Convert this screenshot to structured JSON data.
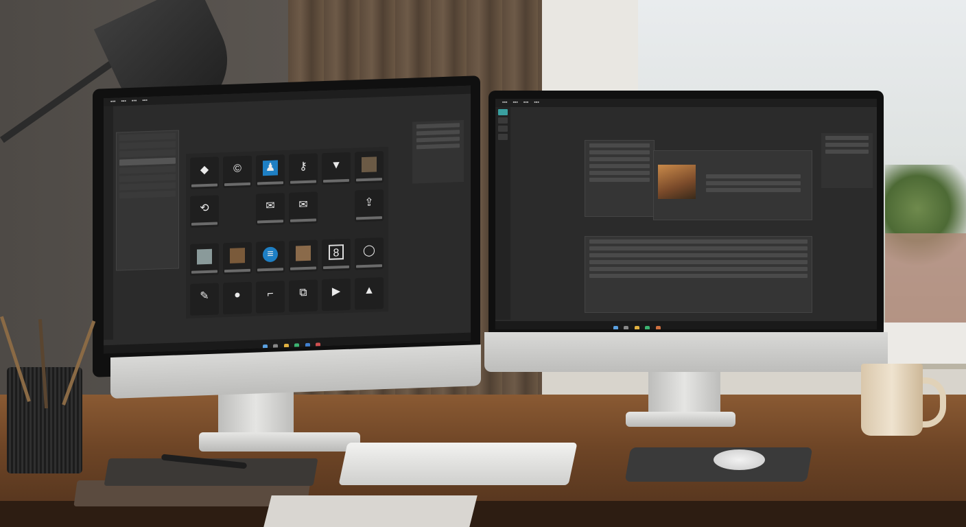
{
  "scene": {
    "description_tags": [
      "desk",
      "two-monitors",
      "lamp",
      "window",
      "mug",
      "keyboard",
      "mouse",
      "pencil-cup",
      "notebooks"
    ]
  },
  "left_monitor": {
    "app_icons": [
      "diamond-icon",
      "copyright-icon",
      "user-icon",
      "key-icon",
      "shield-icon",
      "photo-icon",
      "loop-icon",
      "mail-icon",
      "mail-icon",
      "share-icon",
      "photo-icon",
      "photo-icon",
      "circle-icon",
      "photo-icon",
      "frame-icon",
      "clock-icon",
      "pen-icon",
      "drop-icon",
      "crop-icon",
      "bookmark-icon",
      "play-icon",
      "triangle-icon"
    ],
    "taskbar_icons": [
      "windows-icon",
      "search-icon",
      "folder-icon",
      "browser-icon",
      "store-icon",
      "mail-icon"
    ]
  },
  "right_monitor": {
    "taskbar_icons": [
      "windows-icon",
      "search-icon",
      "folder-icon",
      "browser-icon",
      "settings-icon"
    ]
  },
  "colors": {
    "screen_bg": "#2b2b2b",
    "accent_blue": "#1e7fc4",
    "wood": "#7a4f2c"
  }
}
